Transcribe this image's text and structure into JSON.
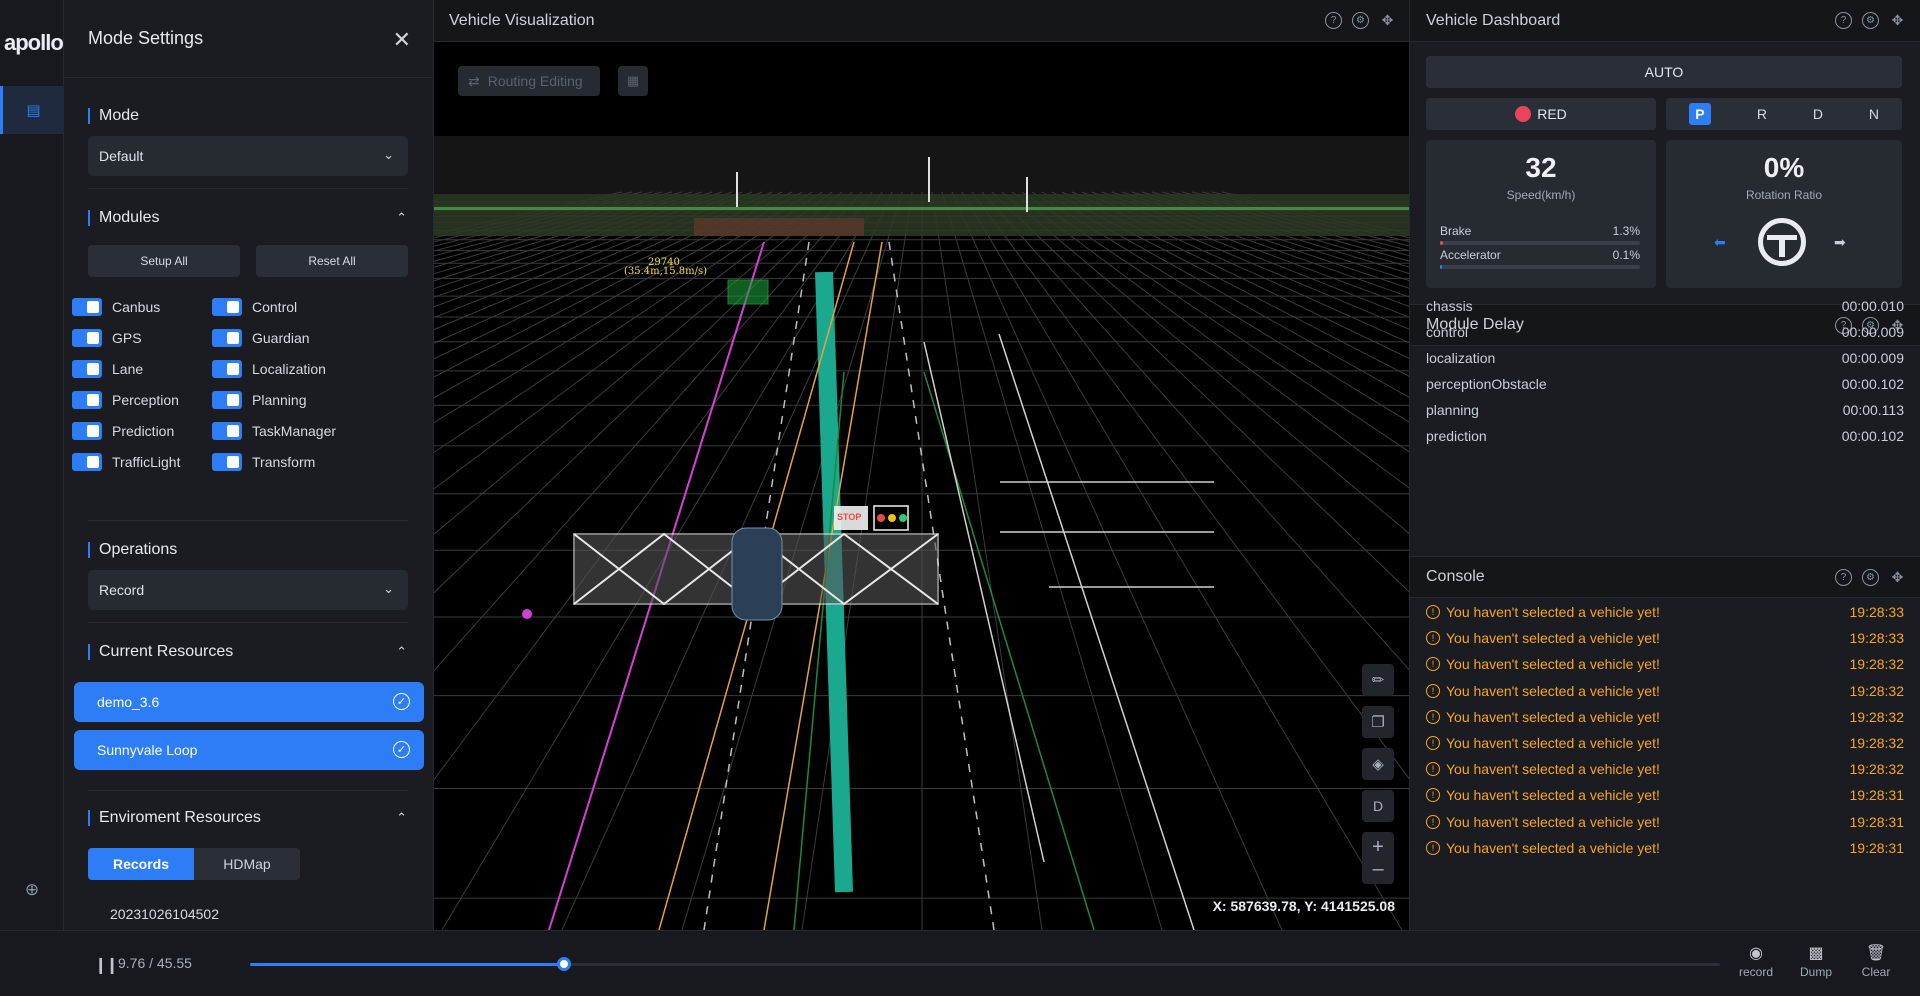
{
  "logo": "apollo",
  "mode_panel": {
    "title": "Mode Settings",
    "mode": {
      "title": "Mode",
      "value": "Default"
    },
    "modules": {
      "title": "Modules",
      "setup_all": "Setup All",
      "reset_all": "Reset All",
      "left": [
        "Canbus",
        "GPS",
        "Lane",
        "Perception",
        "Prediction",
        "TrafficLight"
      ],
      "right": [
        "Control",
        "Guardian",
        "Localization",
        "Planning",
        "TaskManager",
        "Transform"
      ]
    },
    "operations": {
      "title": "Operations",
      "value": "Record"
    },
    "current_resources": {
      "title": "Current Resources",
      "items": [
        "demo_3.6",
        "Sunnyvale Loop"
      ]
    },
    "env_resources": {
      "title": "Enviroment Resources",
      "tabs": [
        "Records",
        "HDMap"
      ],
      "records": [
        "20231026104502"
      ]
    }
  },
  "vis": {
    "title": "Vehicle Visualization",
    "routing_btn": "Routing Editing",
    "obstacle_label": "29740",
    "obstacle_sub": "(35.4m,15.8m/s)",
    "stop_sign": "STOP",
    "tool_d": "D",
    "coords": "X: 587639.78, Y: 4141525.08"
  },
  "dashboard": {
    "title": "Vehicle Dashboard",
    "mode": "AUTO",
    "signal": "RED",
    "gears": [
      "P",
      "R",
      "D",
      "N"
    ],
    "speed": "32",
    "speed_label": "Speed(km/h)",
    "brake_label": "Brake",
    "brake": "1.3%",
    "brake_frac": 0.013,
    "accel_label": "Accelerator",
    "accel": "0.1%",
    "accel_frac": 0.01,
    "rotation": "0%",
    "rotation_label": "Rotation Ratio"
  },
  "module_delay": {
    "title": "Module Delay",
    "rows": [
      {
        "name": "chassis",
        "value": "00:00.010"
      },
      {
        "name": "control",
        "value": "00:00.009"
      },
      {
        "name": "localization",
        "value": "00:00.009"
      },
      {
        "name": "perceptionObstacle",
        "value": "00:00.102"
      },
      {
        "name": "planning",
        "value": "00:00.113"
      },
      {
        "name": "prediction",
        "value": "00:00.102"
      }
    ]
  },
  "console": {
    "title": "Console",
    "rows": [
      {
        "msg": "You haven't selected a vehicle yet!",
        "time": "19:28:33"
      },
      {
        "msg": "You haven't selected a vehicle yet!",
        "time": "19:28:33"
      },
      {
        "msg": "You haven't selected a vehicle yet!",
        "time": "19:28:32"
      },
      {
        "msg": "You haven't selected a vehicle yet!",
        "time": "19:28:32"
      },
      {
        "msg": "You haven't selected a vehicle yet!",
        "time": "19:28:32"
      },
      {
        "msg": "You haven't selected a vehicle yet!",
        "time": "19:28:32"
      },
      {
        "msg": "You haven't selected a vehicle yet!",
        "time": "19:28:32"
      },
      {
        "msg": "You haven't selected a vehicle yet!",
        "time": "19:28:31"
      },
      {
        "msg": "You haven't selected a vehicle yet!",
        "time": "19:28:31"
      },
      {
        "msg": "You haven't selected a vehicle yet!",
        "time": "19:28:31"
      }
    ]
  },
  "player": {
    "time": "9.76 / 45.55",
    "progress": 0.2143,
    "record": "record",
    "dump": "Dump",
    "clear": "Clear"
  }
}
